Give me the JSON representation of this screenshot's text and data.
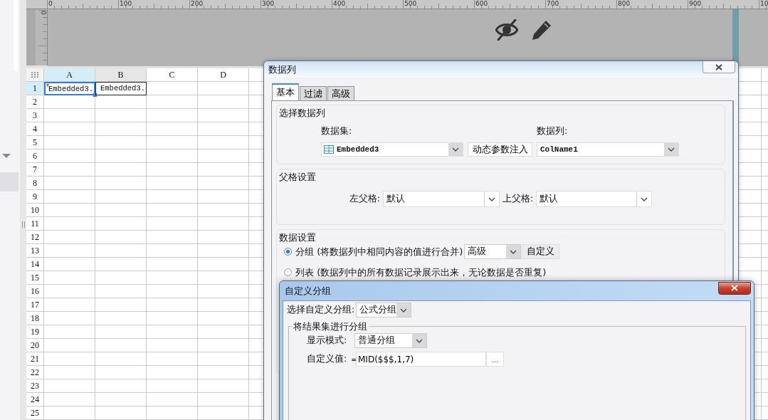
{
  "ruler": {
    "x_labels": [
      "0",
      "100",
      "200",
      "300",
      "400",
      "500",
      "600",
      "700",
      "800",
      "900",
      "10"
    ],
    "y_labels": [
      "0"
    ]
  },
  "sheet": {
    "columns": [
      {
        "label": "A",
        "selected": true,
        "hovered": false
      },
      {
        "label": "B",
        "selected": false,
        "hovered": true
      },
      {
        "label": "C",
        "selected": false,
        "hovered": false
      },
      {
        "label": "D",
        "selected": false,
        "hovered": false
      }
    ],
    "rows": [
      {
        "label": "1",
        "selected": true,
        "cells": [
          {
            "text": "Embedded3.",
            "selected": true
          },
          {
            "text": "Embedded3.",
            "selected": false
          }
        ]
      },
      {
        "label": "2",
        "selected": false
      },
      {
        "label": "3",
        "selected": false
      },
      {
        "label": "4",
        "selected": false
      },
      {
        "label": "5",
        "selected": false
      },
      {
        "label": "6",
        "selected": false
      },
      {
        "label": "7",
        "selected": false
      },
      {
        "label": "8",
        "selected": false
      },
      {
        "label": "9",
        "selected": false
      },
      {
        "label": "10",
        "selected": false
      },
      {
        "label": "11",
        "selected": false
      },
      {
        "label": "12",
        "selected": false
      },
      {
        "label": "13",
        "selected": false
      },
      {
        "label": "14",
        "selected": false
      },
      {
        "label": "15",
        "selected": false
      },
      {
        "label": "16",
        "selected": false
      },
      {
        "label": "17",
        "selected": false
      },
      {
        "label": "18",
        "selected": false
      },
      {
        "label": "19",
        "selected": false
      },
      {
        "label": "20",
        "selected": false
      },
      {
        "label": "21",
        "selected": false
      },
      {
        "label": "22",
        "selected": false
      },
      {
        "label": "23",
        "selected": false
      },
      {
        "label": "24",
        "selected": false
      },
      {
        "label": "25",
        "selected": false
      }
    ]
  },
  "data_column_dialog": {
    "title": "数据列",
    "tabs": [
      {
        "label": "基本",
        "selected": true
      },
      {
        "label": "过滤",
        "selected": false
      },
      {
        "label": "高级",
        "selected": false
      }
    ],
    "select_group": {
      "title": "选择数据列",
      "dataset_label": "数据集:",
      "dataset_value": "Embedded3",
      "inject_button": "动态参数注入",
      "column_label": "数据列:",
      "column_value": "ColName1"
    },
    "parent_group": {
      "title": "父格设置",
      "left_label": "左父格:",
      "left_value": "默认",
      "top_label": "上父格:",
      "top_value": "默认"
    },
    "data_group": {
      "title": "数据设置",
      "options": [
        {
          "label": "分组 (将数据列中相同内容的值进行合并)",
          "selected": true,
          "mode_value": "高级",
          "custom_button": "自定义"
        },
        {
          "label": "列表 (数据列中的所有数据记录展示出来，无论数据是否重复)",
          "selected": false
        }
      ]
    }
  },
  "custom_group_dialog": {
    "title": "自定义分组",
    "select_label": "选择自定义分组:",
    "select_value": "公式分组",
    "group_title": "将结果集进行分组",
    "display_label": "显示模式:",
    "display_value": "普通分组",
    "value_label": "自定义值:",
    "equals": "=",
    "formula": "MID($$$,1,7)",
    "browse_button": "..."
  }
}
